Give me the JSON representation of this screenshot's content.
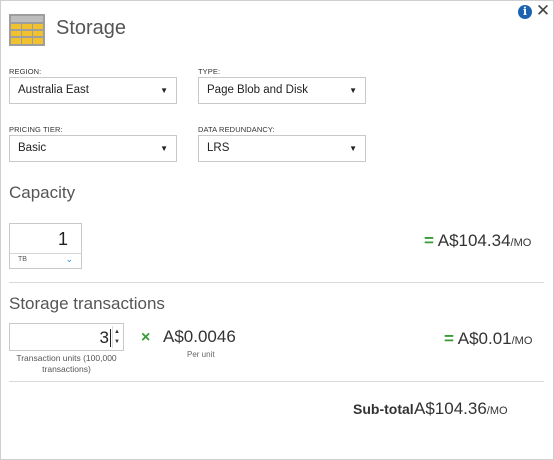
{
  "header": {
    "title": "Storage",
    "icon": "storage-table-icon",
    "info_icon": "info-icon",
    "close_icon": "close-icon",
    "info_glyph": "i",
    "close_glyph": "✕"
  },
  "fields": {
    "region": {
      "label": "REGION:",
      "value": "Australia East"
    },
    "type": {
      "label": "TYPE:",
      "value": "Page Blob and Disk"
    },
    "pricing_tier": {
      "label": "PRICING TIER:",
      "value": "Basic"
    },
    "data_redundancy": {
      "label": "DATA REDUNDANCY:",
      "value": "LRS"
    },
    "caret_glyph": "▼"
  },
  "capacity": {
    "title": "Capacity",
    "value": "1",
    "unit": "TB",
    "chevron_glyph": "⌄",
    "equals": "=",
    "price": "A$104.34",
    "per": "/MO"
  },
  "transactions": {
    "title": "Storage transactions",
    "value": "3",
    "help": "Transaction units (100,000 transactions)",
    "times": "×",
    "unit_price": "A$0.0046",
    "per_unit": "Per unit",
    "equals": "=",
    "price": "A$0.01",
    "per": "/MO",
    "spin_up": "▲",
    "spin_down": "▼"
  },
  "summary": {
    "label": "Sub-total",
    "price": "A$104.36",
    "per": "/MO"
  },
  "colors": {
    "accent_green": "#3a9a3a",
    "icon_yellow": "#f2c12e",
    "info_blue": "#1b63b1",
    "chevron_blue": "#1f9ad6"
  }
}
